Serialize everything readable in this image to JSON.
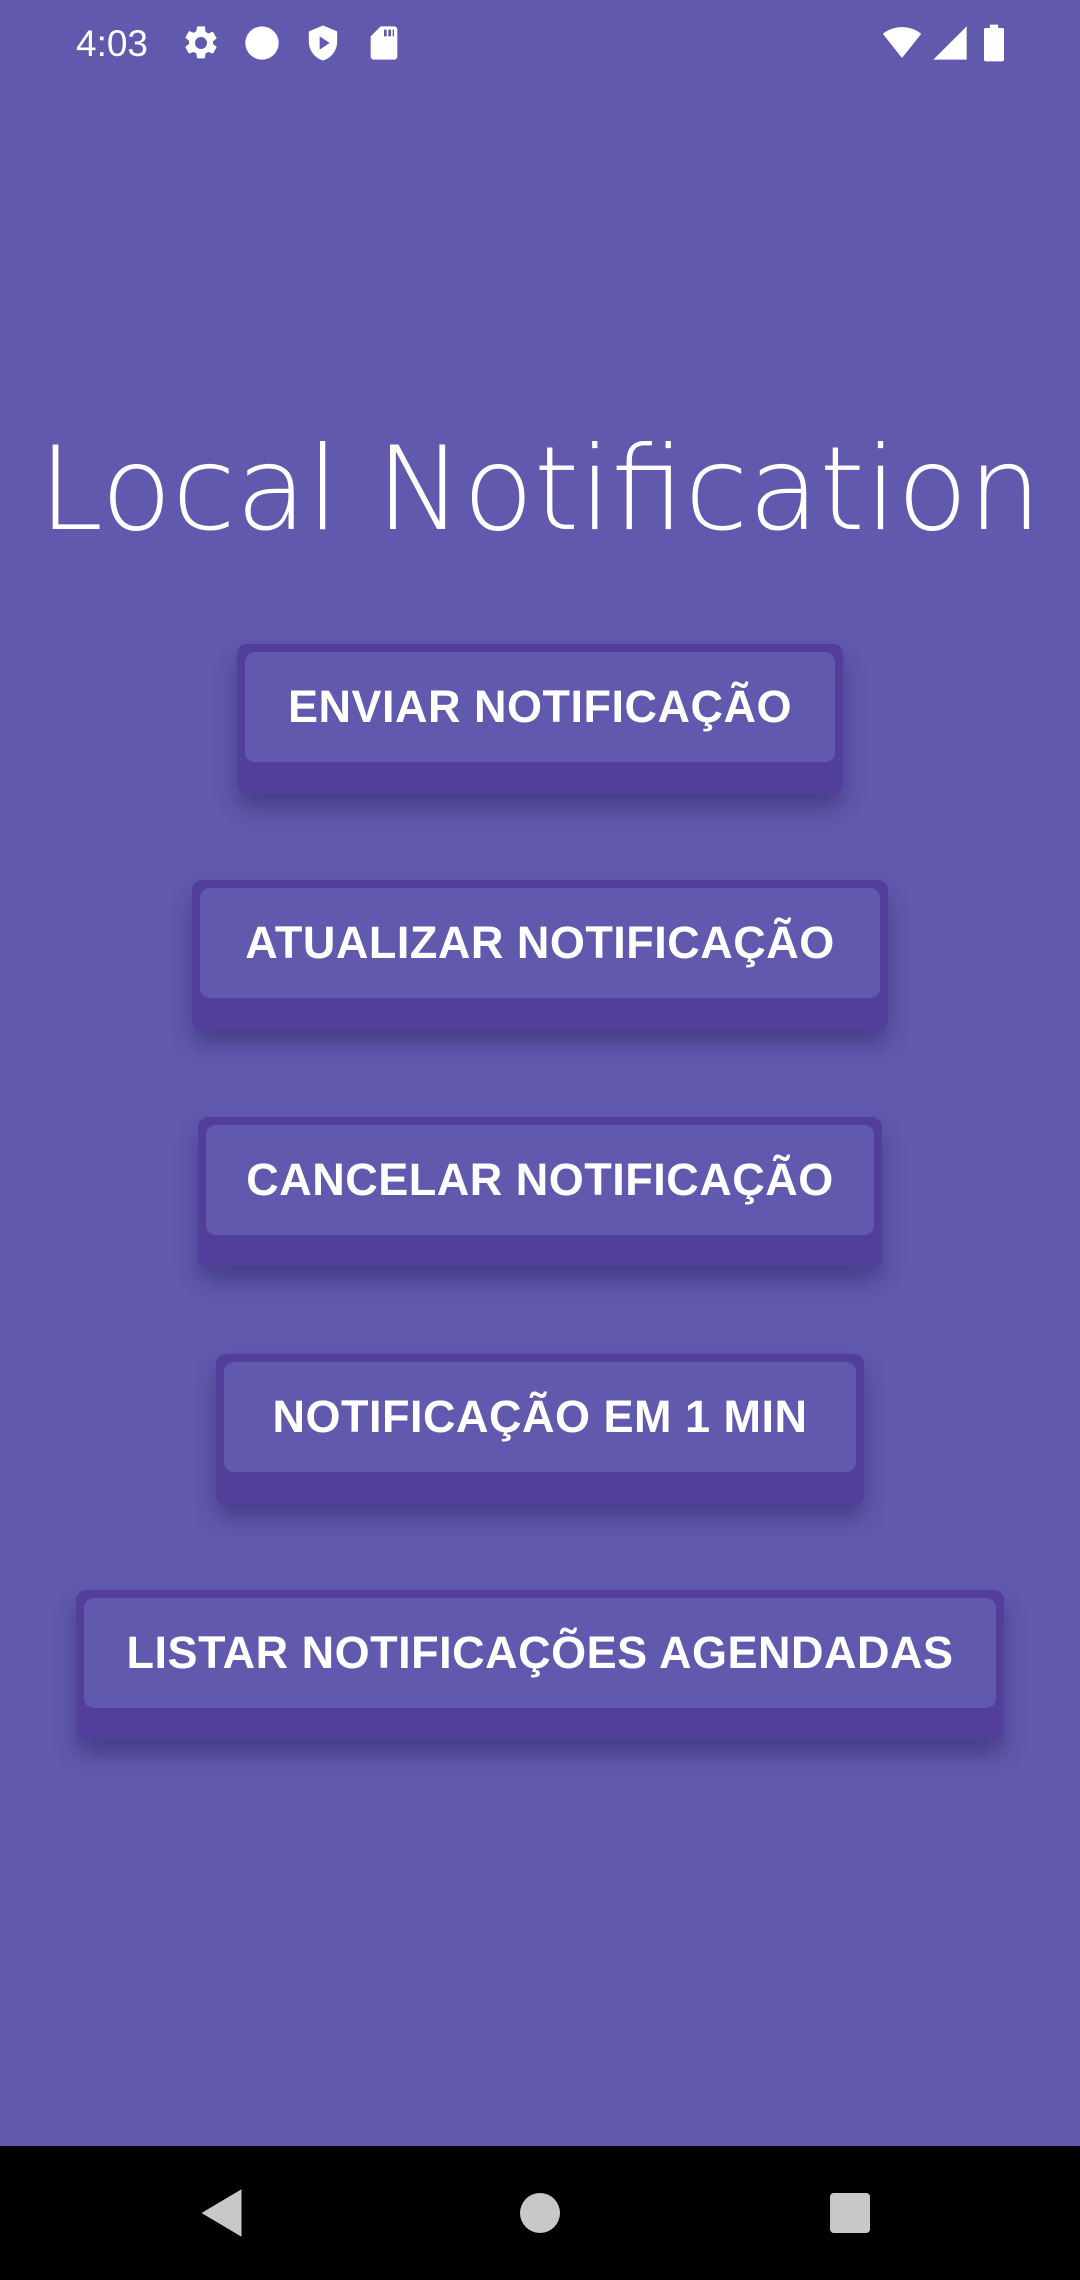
{
  "status_bar": {
    "time": "4:03",
    "left_icons": [
      "gear-icon",
      "circle-icon",
      "shield-play-icon",
      "sd-card-icon"
    ],
    "right_icons": [
      "wifi-icon",
      "cell-signal-icon",
      "battery-icon"
    ]
  },
  "app": {
    "title": "Local Notification",
    "background_color": "#6159ae",
    "button_shadow_color": "#523f9b"
  },
  "buttons": [
    {
      "label": "ENVIAR NOTIFICAÇÃO"
    },
    {
      "label": "ATUALIZAR NOTIFICAÇÃO"
    },
    {
      "label": "CANCELAR NOTIFICAÇÃO"
    },
    {
      "label": "NOTIFICAÇÃO EM 1 MIN"
    },
    {
      "label": "LISTAR NOTIFICAÇÕES AGENDADAS"
    }
  ],
  "nav_bar": {
    "icons": [
      "back-triangle-icon",
      "home-circle-icon",
      "recents-square-icon"
    ]
  }
}
